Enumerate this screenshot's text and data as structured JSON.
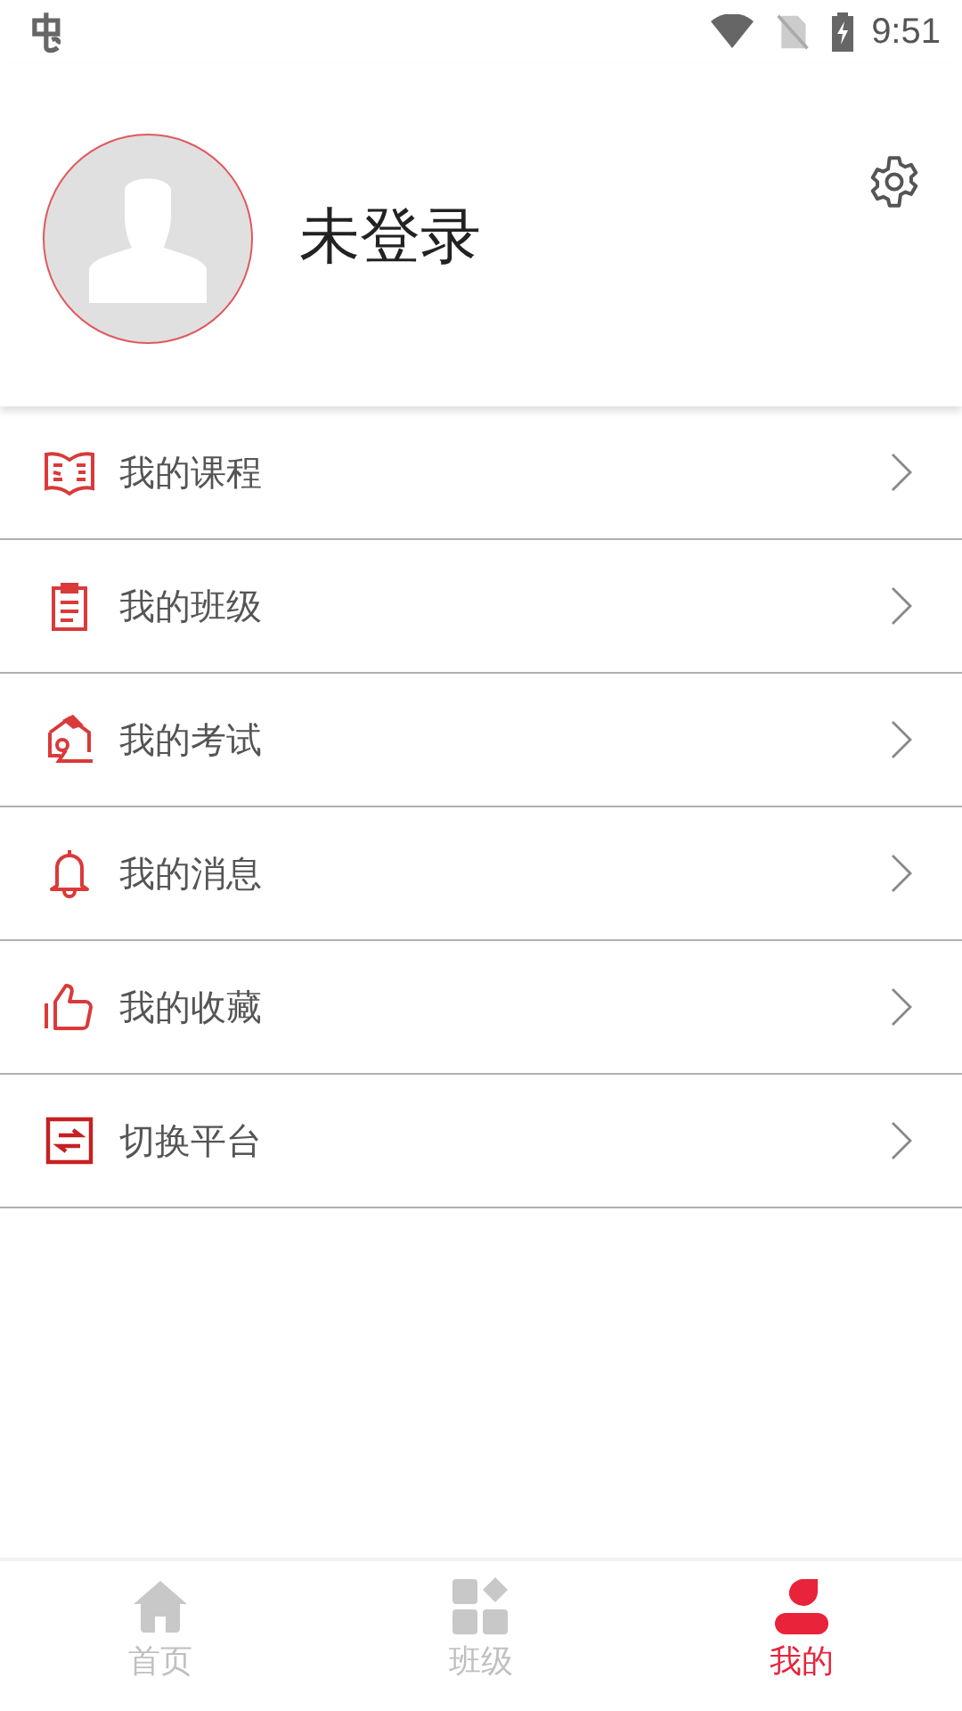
{
  "status_bar": {
    "time": "9:51"
  },
  "profile": {
    "name": "未登录"
  },
  "menu": [
    {
      "kind": "book",
      "label": "我的课程"
    },
    {
      "kind": "clipboard",
      "label": "我的班级"
    },
    {
      "kind": "exam",
      "label": "我的考试"
    },
    {
      "kind": "bell",
      "label": "我的消息"
    },
    {
      "kind": "thumb",
      "label": "我的收藏"
    },
    {
      "kind": "switch",
      "label": "切换平台"
    }
  ],
  "tabs": [
    {
      "kind": "home",
      "label": "首页",
      "selected": false
    },
    {
      "kind": "grid",
      "label": "班级",
      "selected": false
    },
    {
      "kind": "user",
      "label": "我的",
      "selected": true
    }
  ]
}
